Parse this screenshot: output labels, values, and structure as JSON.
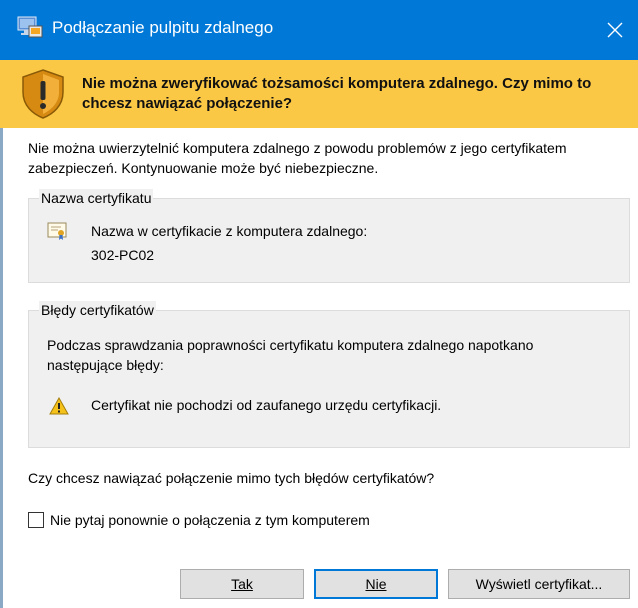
{
  "window": {
    "title": "Podłączanie pulpitu zdalnego"
  },
  "banner": {
    "message": "Nie można zweryfikować tożsamości komputera zdalnego. Czy mimo to chcesz nawiązać połączenie?"
  },
  "description": "Nie można uwierzytelnić komputera zdalnego z powodu problemów z jego certyfikatem zabezpieczeń. Kontynuowanie może być niebezpieczne.",
  "certificate_name": {
    "caption": "Nazwa certyfikatu",
    "label": "Nazwa w certyfikacie z komputera zdalnego:",
    "value": "302-PC02"
  },
  "certificate_errors": {
    "caption": "Błędy certyfikatów",
    "description": "Podczas sprawdzania poprawności certyfikatu komputera zdalnego napotkano następujące błędy:",
    "items": [
      "Certyfikat nie pochodzi od zaufanego urzędu certyfikacji."
    ]
  },
  "question": "Czy chcesz nawiązać połączenie mimo tych błędów certyfikatów?",
  "dont_ask": {
    "label": "Nie pytaj ponownie o połączenia z tym komputerem",
    "checked": false
  },
  "buttons": {
    "yes": "Tak",
    "no": "Nie",
    "view": "Wyświetl certyfikat..."
  },
  "colors": {
    "titlebar": "#0078d7",
    "banner": "#fbc846"
  },
  "icons": {
    "app": "remote-desktop-icon",
    "close": "close-icon",
    "banner": "warning-shield-icon",
    "certificate": "certificate-icon",
    "error": "warning-triangle-icon"
  }
}
